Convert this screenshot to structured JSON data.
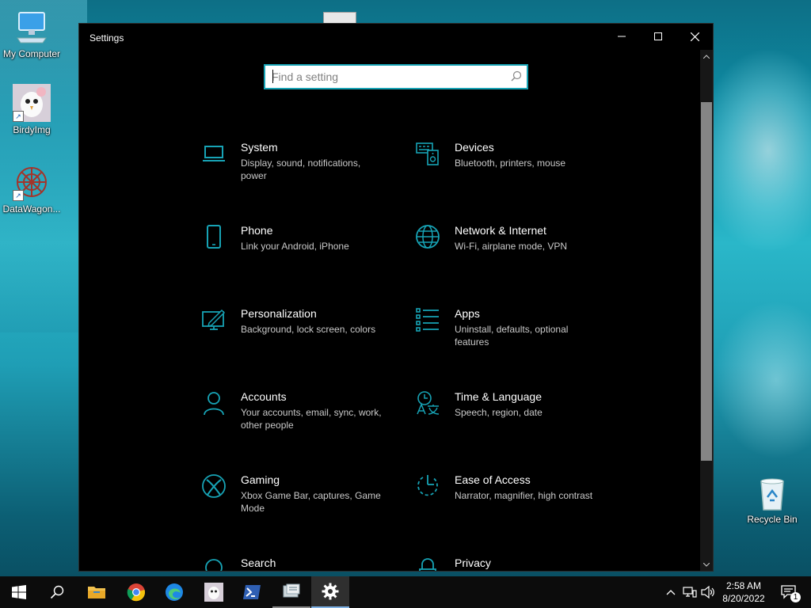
{
  "desktop": {
    "icons": [
      {
        "label": "My Computer"
      },
      {
        "label": "BirdyImg"
      },
      {
        "label": "DataWagon..."
      },
      {
        "label": "Recycle Bin"
      }
    ]
  },
  "window": {
    "title": "Settings",
    "search_placeholder": "Find a setting",
    "categories": [
      {
        "name": "System",
        "desc": "Display, sound, notifications, power",
        "icon": "laptop-icon"
      },
      {
        "name": "Devices",
        "desc": "Bluetooth, printers, mouse",
        "icon": "devices-icon"
      },
      {
        "name": "Phone",
        "desc": "Link your Android, iPhone",
        "icon": "phone-icon"
      },
      {
        "name": "Network & Internet",
        "desc": "Wi-Fi, airplane mode, VPN",
        "icon": "globe-icon"
      },
      {
        "name": "Personalization",
        "desc": "Background, lock screen, colors",
        "icon": "paint-icon"
      },
      {
        "name": "Apps",
        "desc": "Uninstall, defaults, optional features",
        "icon": "apps-list-icon"
      },
      {
        "name": "Accounts",
        "desc": "Your accounts, email, sync, work, other people",
        "icon": "person-icon"
      },
      {
        "name": "Time & Language",
        "desc": "Speech, region, date",
        "icon": "time-language-icon"
      },
      {
        "name": "Gaming",
        "desc": "Xbox Game Bar, captures, Game Mode",
        "icon": "xbox-icon"
      },
      {
        "name": "Ease of Access",
        "desc": "Narrator, magnifier, high contrast",
        "icon": "ease-of-access-icon"
      },
      {
        "name": "Search",
        "desc": "",
        "icon": "search-icon"
      },
      {
        "name": "Privacy",
        "desc": "",
        "icon": "lock-icon"
      }
    ]
  },
  "taskbar": {
    "apps": [
      "start-icon",
      "search-icon",
      "file-explorer-icon",
      "chrome-icon",
      "edge-icon",
      "birdyimg-icon",
      "powershell-icon",
      "server-manager-icon",
      "settings-gear-icon"
    ],
    "clock": {
      "time": "2:58 AM",
      "date": "8/20/2022"
    },
    "notification_count": "1"
  },
  "colors": {
    "accent": "#17a3b5",
    "window_bg": "#000000",
    "taskbar_bg": "#0c0c0c"
  }
}
